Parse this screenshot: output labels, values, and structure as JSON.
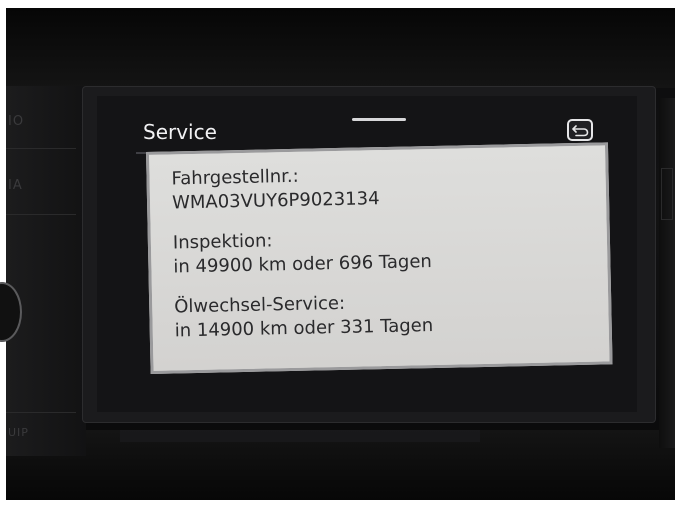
{
  "left_panel": {
    "buttons": [
      "IO",
      "IA",
      "UIP"
    ]
  },
  "screen": {
    "title": "Service",
    "back_icon": "back-arrow-icon",
    "info": {
      "chassis_label": "Fahrgestellnr.:",
      "chassis_value": "WMA03VUY6P9023134",
      "inspection_label": "Inspektion:",
      "inspection_value": "in 49900 km oder 696 Tagen",
      "oil_label": "Ölwechsel-Service:",
      "oil_value": "in 14900 km oder 331 Tagen"
    }
  },
  "colors": {
    "bezel": "#0e0e0f",
    "screen_bg": "#141416",
    "panel_bg": "#d9d8d7",
    "panel_text": "#2a2a2c",
    "title_text": "#f2f2f4"
  }
}
